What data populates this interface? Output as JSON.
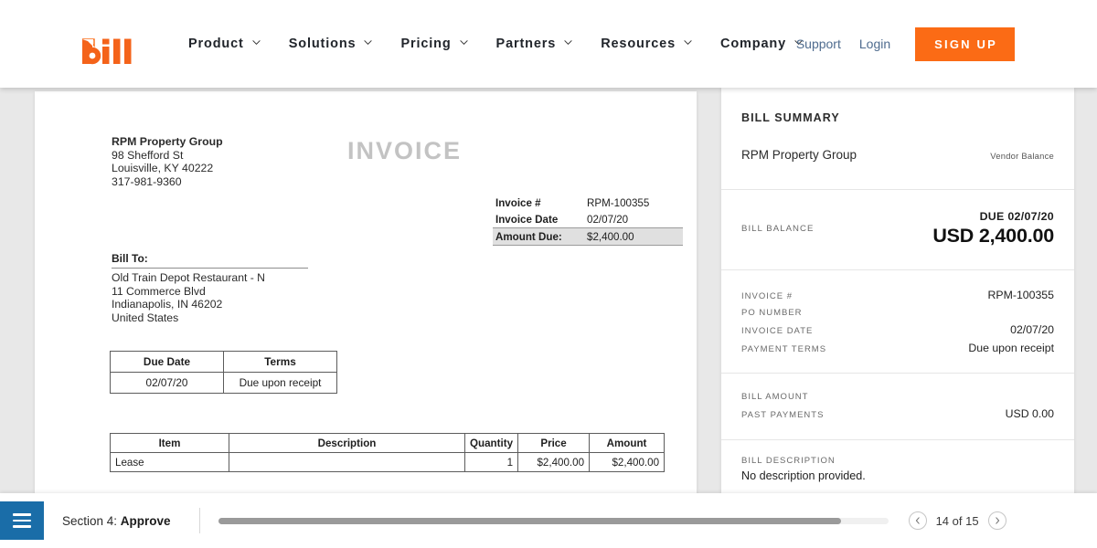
{
  "topnav": {
    "logo_text": "bill",
    "nav_items": [
      {
        "label": "Product",
        "icon": "chevron-down-icon"
      },
      {
        "label": "Solutions",
        "icon": "chevron-down-icon"
      },
      {
        "label": "Pricing",
        "icon": "chevron-down-icon"
      },
      {
        "label": "Partners",
        "icon": "chevron-down-icon"
      },
      {
        "label": "Resources",
        "icon": "chevron-down-icon"
      },
      {
        "label": "Company",
        "icon": "chevron-down-icon"
      }
    ],
    "support_label": "Support",
    "login_label": "Login",
    "signup_label": "SIGN UP",
    "accent_color": "#fb6b15",
    "link_color": "#4f6c8f"
  },
  "invoice": {
    "heading": "INVOICE",
    "vendor": {
      "name": "RPM Property Group",
      "address1": "98 Shefford St",
      "address2": "Louisville, KY 40222",
      "phone": "317-981-9360"
    },
    "meta": {
      "invoice_no_label": "Invoice #",
      "invoice_no_value": "RPM-100355",
      "invoice_date_label": "Invoice Date",
      "invoice_date_value": "02/07/20",
      "amount_due_label": "Amount Due:",
      "amount_due_value": "$2,400.00"
    },
    "bill_to": {
      "heading": "Bill To:",
      "line1": "Old Train Depot Restaurant - N",
      "line2": "11 Commerce Blvd",
      "line3": "Indianapolis, IN 46202",
      "line4": "United States"
    },
    "terms_table": {
      "headers": [
        "Due Date",
        "Terms"
      ],
      "row": [
        "02/07/20",
        "Due upon receipt"
      ]
    },
    "items_table": {
      "headers": [
        "Item",
        "Description",
        "Quantity",
        "Price",
        "Amount"
      ],
      "rows": [
        {
          "item": "Lease",
          "description": "",
          "quantity": "1",
          "price": "$2,400.00",
          "amount": "$2,400.00"
        }
      ]
    }
  },
  "bill_summary": {
    "title": "BILL SUMMARY",
    "vendor_name": "RPM Property Group",
    "vendor_balance_label": "Vendor Balance",
    "bill_balance_label": "BILL BALANCE",
    "due_label": "DUE 02/07/20",
    "balance_amount": "USD 2,400.00",
    "details": [
      {
        "key": "INVOICE #",
        "value": "RPM-100355"
      },
      {
        "key": "PO NUMBER",
        "value": ""
      },
      {
        "key": "INVOICE DATE",
        "value": "02/07/20"
      },
      {
        "key": "PAYMENT TERMS",
        "value": "Due upon receipt"
      }
    ],
    "amounts": [
      {
        "key": "BILL AMOUNT",
        "value": ""
      },
      {
        "key": "PAST PAYMENTS",
        "value": "USD 0.00"
      }
    ],
    "description_label": "BILL DESCRIPTION",
    "description_value": "No description provided."
  },
  "bottombar": {
    "menu_icon": "hamburger-menu-icon",
    "section_prefix": "Section 4: ",
    "section_name": "Approve",
    "progress_percent": 93,
    "prev_icon": "chevron-left-icon",
    "next_icon": "chevron-right-icon",
    "pager_text": "14 of 15",
    "menu_color": "#1a6da8"
  }
}
